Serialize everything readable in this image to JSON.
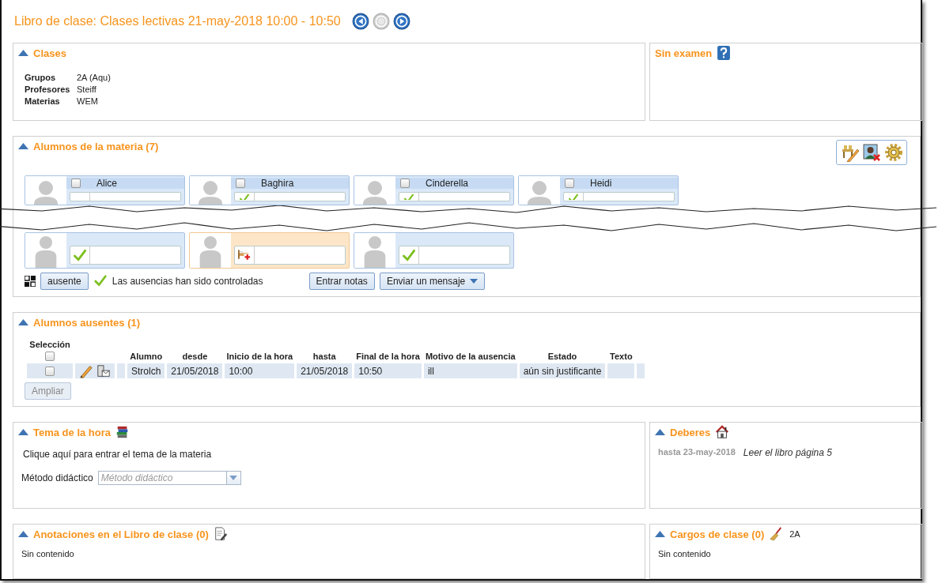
{
  "header": {
    "title": "Libro de clase: Clases lectivas 21-may-2018 10:00 - 10:50",
    "nav": [
      {
        "kind": "prev",
        "disabled": false
      },
      {
        "kind": "current",
        "disabled": true
      },
      {
        "kind": "next",
        "disabled": false
      }
    ]
  },
  "classes": {
    "title": "Clases",
    "expanded": true,
    "rows": [
      {
        "label": "Grupos",
        "value": "2A (Aqu)"
      },
      {
        "label": "Profesores",
        "value": "Steiff"
      },
      {
        "label": "Materias",
        "value": "WEM"
      }
    ]
  },
  "exam": {
    "title": "Sin examen"
  },
  "students": {
    "title": "Alumnos de la materia (7)",
    "expanded": true,
    "cards_top": [
      {
        "name": "Alice",
        "checked": false,
        "kind": "blank"
      },
      {
        "name": "Baghira",
        "checked": false,
        "kind": "present"
      },
      {
        "name": "Cinderella",
        "checked": false,
        "kind": "present"
      },
      {
        "name": "Heidi",
        "checked": false,
        "kind": "present"
      }
    ],
    "cards_bottom": [
      {
        "kind": "present"
      },
      {
        "kind": "absent"
      },
      {
        "kind": "present"
      }
    ],
    "absent_button": "ausente",
    "controlled_text": "Las ausencias han sido controladas",
    "grades_button": "Entrar notas",
    "message_button": "Enviar un mensaje"
  },
  "absent": {
    "title": "Alumnos ausentes (1)",
    "expanded": true,
    "select_label": "Selección",
    "all_selected": false,
    "columns": [
      "Alumno",
      "desde",
      "Inicio de la hora",
      "hasta",
      "Final de la hora",
      "Motivo de la ausencia",
      "Estado",
      "Texto"
    ],
    "rows": [
      {
        "selected": false,
        "cells": [
          "Strolch",
          "21/05/2018",
          "10:00",
          "21/05/2018",
          "10:50",
          "ill",
          "aún sin justificante"
        ]
      }
    ],
    "expand_button": {
      "label": "Ampliar",
      "disabled": true
    }
  },
  "topic": {
    "title": "Tema de la hora",
    "expanded": true,
    "prompt": "Clique aquí para entrar el tema de la materia",
    "method_label": "Método didáctico",
    "method_placeholder": "Método didáctico"
  },
  "homework": {
    "title": "Deberes",
    "expanded": true,
    "items": [
      {
        "due": "hasta 23-may-2018",
        "text": "Leer el libro página 5"
      }
    ]
  },
  "notes": {
    "title": "Anotaciones en el Libro de clase (0)",
    "expanded": true,
    "empty": "Sin contenido"
  },
  "duties": {
    "title": "Cargos de clase (0)",
    "expanded": true,
    "class_name": "2A",
    "empty": "Sin contenido"
  }
}
